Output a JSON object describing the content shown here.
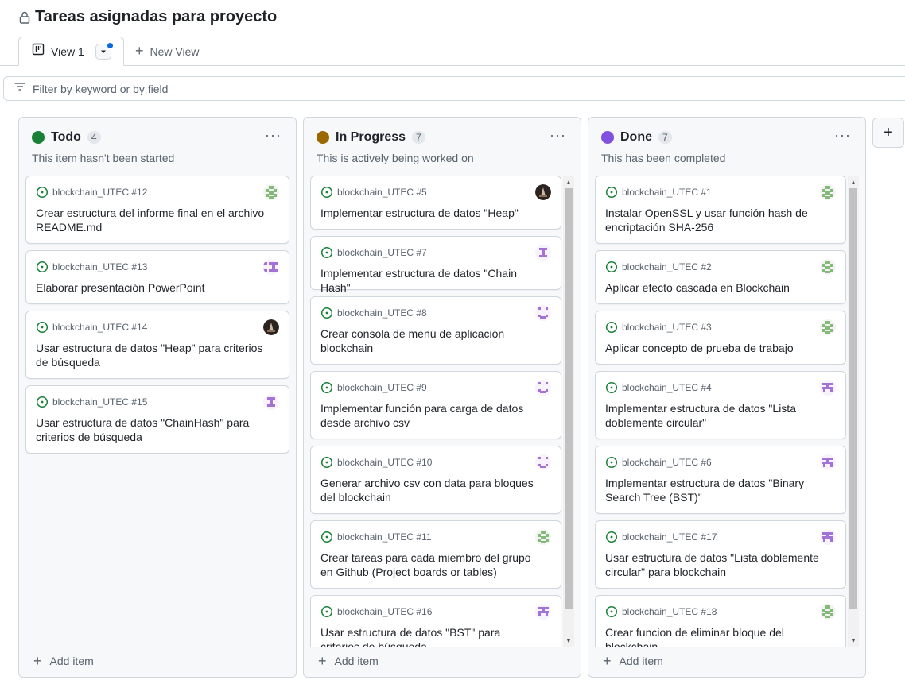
{
  "page": {
    "title": "Tareas asignadas para proyecto"
  },
  "tabs": {
    "view1_label": "View 1",
    "new_view_label": "New View"
  },
  "filter": {
    "placeholder": "Filter by keyword or by field"
  },
  "colors": {
    "todo": "#1a7f37",
    "in_progress": "#9a6700",
    "done": "#8250df",
    "issue_open": "#1a7f37"
  },
  "columns": [
    {
      "name": "Todo",
      "count": "4",
      "description": "This item hasn't been started",
      "dot_color": "#1a7f37",
      "add_label": "Add item",
      "cards": [
        {
          "meta": "blockchain_UTEC #12",
          "title": "Crear estructura del informe final en el archivo README.md",
          "avatar": "green-pixel"
        },
        {
          "meta": "blockchain_UTEC #13",
          "title": "Elaborar presentación PowerPoint",
          "avatar": "purple-pixel-double"
        },
        {
          "meta": "blockchain_UTEC #14",
          "title": "Usar estructura de datos \"Heap\" para criterios de búsqueda",
          "avatar": "dark-photo"
        },
        {
          "meta": "blockchain_UTEC #15",
          "title": "Usar estructura de datos \"ChainHash\" para criterios de búsqueda",
          "avatar": "purple-pixel-i"
        }
      ]
    },
    {
      "name": "In Progress",
      "count": "7",
      "description": "This is actively being worked on",
      "dot_color": "#9a6700",
      "add_label": "Add item",
      "cards": [
        {
          "meta": "blockchain_UTEC #5",
          "title": "Implementar estructura de datos \"Heap\"",
          "avatar": "dark-photo"
        },
        {
          "meta": "blockchain_UTEC #7",
          "title": "Implementar estructura de datos \"Chain Hash\"",
          "avatar": "purple-pixel-i"
        },
        {
          "meta": "blockchain_UTEC #8",
          "title": "Crear consola de menú de aplicación blockchain",
          "avatar": "purple-pixel-u"
        },
        {
          "meta": "blockchain_UTEC #9",
          "title": "Implementar función para carga de datos desde archivo csv",
          "avatar": "purple-pixel-u"
        },
        {
          "meta": "blockchain_UTEC #10",
          "title": "Generar archivo csv con data para bloques del blockchain",
          "avatar": "purple-pixel-u"
        },
        {
          "meta": "blockchain_UTEC #11",
          "title": "Crear tareas para cada miembro del grupo en Github (Project boards or tables)",
          "avatar": "green-pixel"
        },
        {
          "meta": "blockchain_UTEC #16",
          "title": "Usar estructura de datos \"BST\" para criterios de búsqueda",
          "avatar": "purple-pixel-t"
        }
      ]
    },
    {
      "name": "Done",
      "count": "7",
      "description": "This has been completed",
      "dot_color": "#8250df",
      "add_label": "Add item",
      "cards": [
        {
          "meta": "blockchain_UTEC #1",
          "title": "Instalar OpenSSL y usar función hash de encriptación SHA-256",
          "avatar": "green-pixel"
        },
        {
          "meta": "blockchain_UTEC #2",
          "title": "Aplicar efecto cascada en Blockchain",
          "avatar": "green-pixel"
        },
        {
          "meta": "blockchain_UTEC #3",
          "title": "Aplicar concepto de prueba de trabajo",
          "avatar": "green-pixel"
        },
        {
          "meta": "blockchain_UTEC #4",
          "title": "Implementar estructura de datos \"Lista doblemente circular\"",
          "avatar": "purple-pixel-t"
        },
        {
          "meta": "blockchain_UTEC #6",
          "title": "Implementar estructura de datos \"Binary Search Tree (BST)\"",
          "avatar": "purple-pixel-t"
        },
        {
          "meta": "blockchain_UTEC #17",
          "title": "Usar estructura de datos \"Lista doblemente circular\" para blockchain",
          "avatar": "purple-pixel-t"
        },
        {
          "meta": "blockchain_UTEC #18",
          "title": "Crear funcion de eliminar bloque del blockchain",
          "avatar": "green-pixel"
        }
      ]
    }
  ]
}
